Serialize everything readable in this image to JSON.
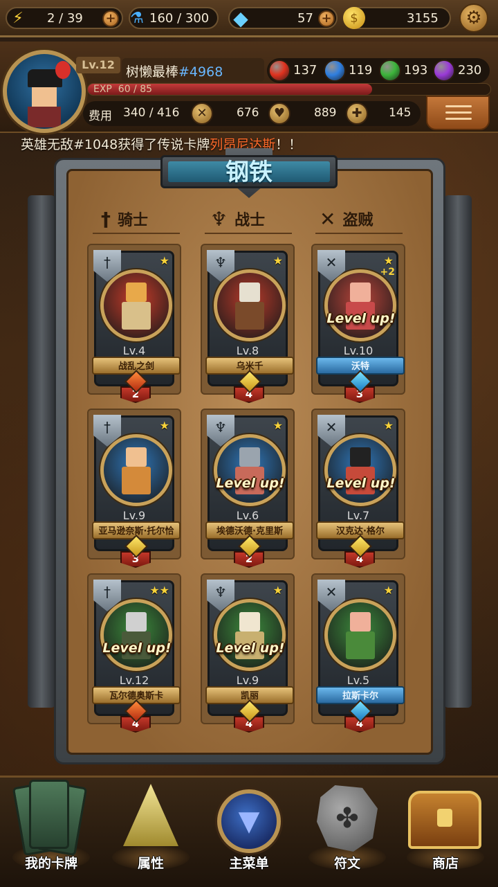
{
  "topbar": {
    "energy": "2 / 39",
    "potion": "160 / 300",
    "gems": "57",
    "gold": "3155"
  },
  "player": {
    "level": "Lv.12",
    "name": "树懒最棒",
    "tag": "#4968",
    "exp_label": "EXP",
    "exp_value": "60 / 85",
    "exp_fraction": 0.706,
    "orbs": [
      {
        "name": "red",
        "value": "137",
        "color": "#e0321e"
      },
      {
        "name": "blue",
        "value": "119",
        "color": "#2f7fe0"
      },
      {
        "name": "green",
        "value": "193",
        "color": "#3cb43a"
      },
      {
        "name": "purple",
        "value": "230",
        "color": "#9a3ad8"
      }
    ],
    "cost_label": "费用",
    "cost_value": "340 / 416",
    "attack": "676",
    "health": "889",
    "heal": "145"
  },
  "broadcast": {
    "prefix": "英雄无敌#1048获得了传说卡牌",
    "highlight": "列昂尼达斯",
    "suffix": "！！"
  },
  "board": {
    "title": "钢铁",
    "columns": [
      {
        "label": "骑士",
        "icon": "sword-icon"
      },
      {
        "label": "战士",
        "icon": "axe-icon"
      },
      {
        "label": "盗贼",
        "icon": "crossed-daggers-icon"
      }
    ]
  },
  "cards": [
    {
      "id": "card-1",
      "stars": "★",
      "plus": "",
      "level": "Lv.4",
      "name": "战乱之剑",
      "ribbon": "gold",
      "gem": "red",
      "count": "2",
      "levelup": "",
      "portrait": "#c83c2a",
      "head": "#e8a94a",
      "body": "#d9c08a"
    },
    {
      "id": "card-2",
      "stars": "★",
      "plus": "",
      "level": "Lv.8",
      "name": "乌米千",
      "ribbon": "gold",
      "gem": "gold",
      "count": "4",
      "levelup": "",
      "portrait": "#b83a2a",
      "head": "#e6e0d0",
      "body": "#7a4a2a"
    },
    {
      "id": "card-3",
      "stars": "★",
      "plus": "+2",
      "level": "Lv.10",
      "name": "沃特",
      "ribbon": "blue",
      "gem": "blue",
      "count": "3",
      "levelup": "Level up!",
      "portrait": "#b8443a",
      "head": "#f0b09a",
      "body": "#c84a4a"
    },
    {
      "id": "card-4",
      "stars": "★",
      "plus": "",
      "level": "Lv.9",
      "name": "亚马逊奈斯·托尔恰",
      "ribbon": "gold",
      "gem": "gold",
      "count": "3",
      "levelup": "",
      "portrait": "#2f76b8",
      "head": "#f0c090",
      "body": "#d48a3a"
    },
    {
      "id": "card-5",
      "stars": "★",
      "plus": "",
      "level": "Lv.6",
      "name": "埃德沃德·克里斯",
      "ribbon": "gold",
      "gem": "gold",
      "count": "2",
      "levelup": "Level up!",
      "portrait": "#2f76b8",
      "head": "#9aa4ae",
      "body": "#c86a5a"
    },
    {
      "id": "card-6",
      "stars": "★",
      "plus": "",
      "level": "Lv.7",
      "name": "汉克达·格尔",
      "ribbon": "gold",
      "gem": "gold",
      "count": "4",
      "levelup": "Level up!",
      "portrait": "#2f76b8",
      "head": "#222222",
      "body": "#c64a3a"
    },
    {
      "id": "card-7",
      "stars": "★★",
      "plus": "",
      "level": "Lv.12",
      "name": "瓦尔德奥斯卡",
      "ribbon": "gold",
      "gem": "red",
      "count": "4",
      "levelup": "Level up!",
      "portrait": "#3c8a3c",
      "head": "#d0d0d0",
      "body": "#4a5a3a"
    },
    {
      "id": "card-8",
      "stars": "★",
      "plus": "",
      "level": "Lv.9",
      "name": "凯丽",
      "ribbon": "gold",
      "gem": "gold",
      "count": "4",
      "levelup": "Level up!",
      "portrait": "#3c8a3c",
      "head": "#f0e6d0",
      "body": "#c8b070"
    },
    {
      "id": "card-9",
      "stars": "★",
      "plus": "",
      "level": "Lv.5",
      "name": "拉斯卡尔",
      "ribbon": "blue",
      "gem": "blue",
      "count": "4",
      "levelup": "",
      "portrait": "#3c8a3c",
      "head": "#f0b09a",
      "body": "#4a8a3a"
    }
  ],
  "nav": {
    "my_cards": "我的卡牌",
    "attributes": "属性",
    "main_menu": "主菜单",
    "runes": "符文",
    "shop": "商店"
  }
}
